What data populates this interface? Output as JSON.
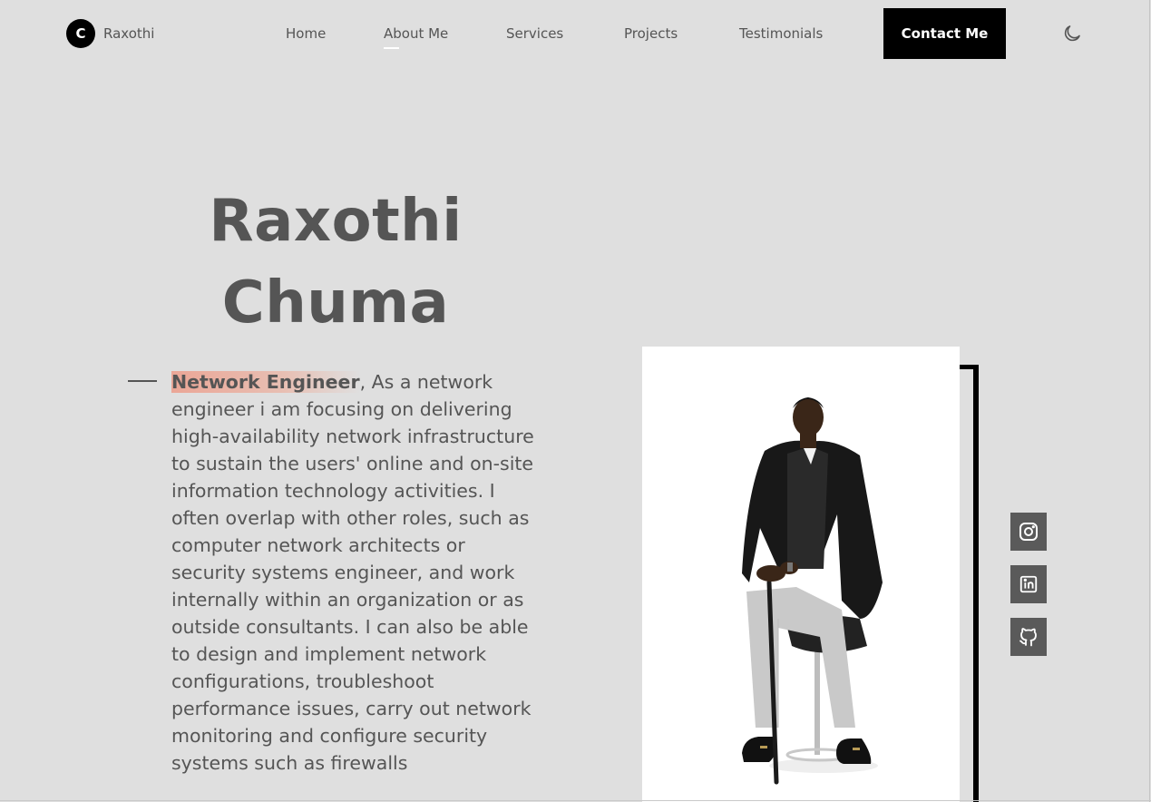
{
  "header": {
    "logo_letter": "C",
    "brand_name": "Raxothi",
    "nav": [
      {
        "label": "Home"
      },
      {
        "label": "About Me"
      },
      {
        "label": "Services"
      },
      {
        "label": "Projects"
      },
      {
        "label": "Testimonials"
      }
    ],
    "active_nav": "About Me",
    "contact_label": "Contact Me",
    "theme_icon": "moon-icon"
  },
  "hero": {
    "first_name": "Raxothi",
    "last_name": "Chuma",
    "role": "Network Engineer",
    "description": ", As a network engineer i am focusing on delivering high-availability network infrastructure to sustain the users' online and on-site information technology activities. I often overlap with other roles, such as computer network architects or security systems engineer, and work internally within an organization or as outside consultants. I can also be able to design and implement network configurations, troubleshoot performance issues, carry out network monitoring and configure security systems such as firewalls"
  },
  "social": [
    {
      "icon": "instagram-icon"
    },
    {
      "icon": "linkedin-icon"
    },
    {
      "icon": "github-icon"
    }
  ],
  "colors": {
    "background": "#dfdfdf",
    "text": "#555555",
    "accent": "#000000",
    "highlight": "#ee9682",
    "social_bg": "#5a5a5a"
  }
}
